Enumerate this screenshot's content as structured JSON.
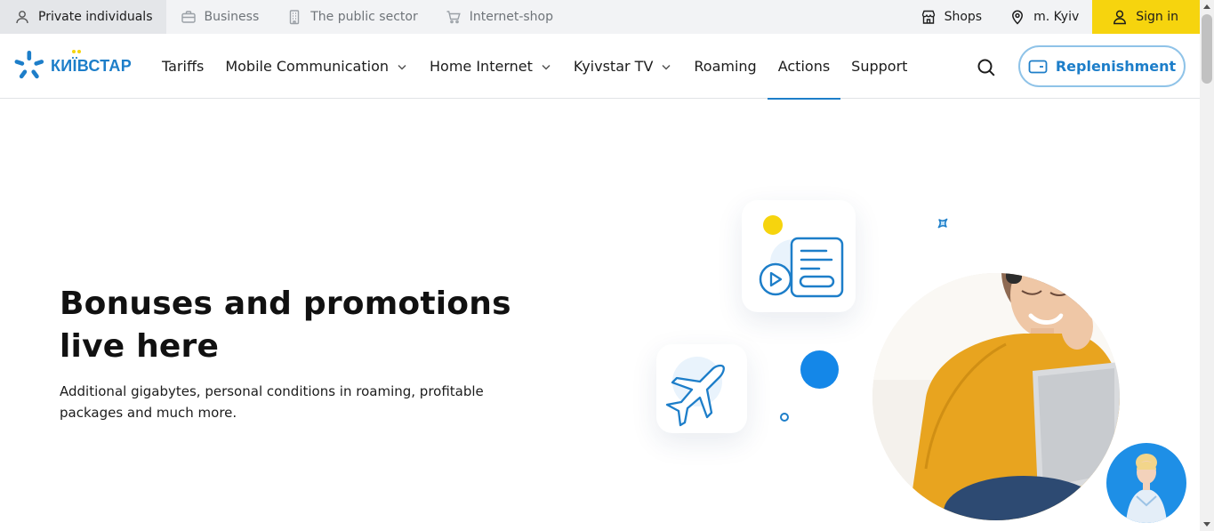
{
  "topbar": {
    "segments": [
      {
        "label": "Private individuals",
        "icon": "person-icon"
      },
      {
        "label": "Business",
        "icon": "briefcase-icon"
      },
      {
        "label": "The public sector",
        "icon": "building-icon"
      },
      {
        "label": "Internet-shop",
        "icon": "cart-icon"
      }
    ],
    "active_segment": "Private individuals",
    "shops_label": "Shops",
    "city_label": "m. Kyiv",
    "signin_label": "Sign in"
  },
  "brand": {
    "logo_text": "КИЇВСТАР",
    "accent_color": "#1d7ec9",
    "yellow_color": "#f6d40e"
  },
  "nav": {
    "items": [
      {
        "label": "Tariffs",
        "has_dropdown": false
      },
      {
        "label": "Mobile Communication",
        "has_dropdown": true
      },
      {
        "label": "Home Internet",
        "has_dropdown": true
      },
      {
        "label": "Kyivstar TV",
        "has_dropdown": true
      },
      {
        "label": "Roaming",
        "has_dropdown": false
      },
      {
        "label": "Actions",
        "has_dropdown": false
      },
      {
        "label": "Support",
        "has_dropdown": false
      }
    ],
    "active_item": "Actions",
    "replenish_label": "Replenishment"
  },
  "hero": {
    "title": "Bonuses and promotions live here",
    "subtitle": "Additional gigabytes, personal conditions in roaming, profitable packages and much more."
  }
}
